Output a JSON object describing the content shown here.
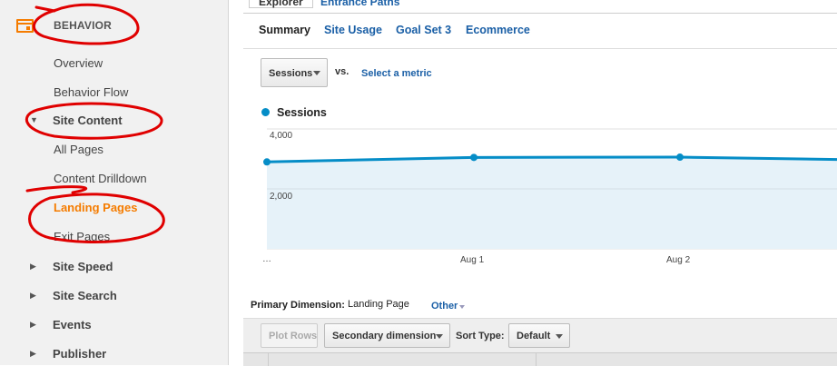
{
  "sidebar": {
    "section_title": "BEHAVIOR",
    "items": [
      {
        "label": "Overview"
      },
      {
        "label": "Behavior Flow"
      },
      {
        "label": "Site Content"
      },
      {
        "label": "All Pages"
      },
      {
        "label": "Content Drilldown"
      },
      {
        "label": "Landing Pages"
      },
      {
        "label": "Exit Pages"
      },
      {
        "label": "Site Speed"
      },
      {
        "label": "Site Search"
      },
      {
        "label": "Events"
      },
      {
        "label": "Publisher"
      }
    ],
    "active_item": "Landing Pages",
    "active_color": "#f57c00",
    "annotation_color": "#e00000"
  },
  "top_tabs": [
    "Explorer",
    "Entrance Paths"
  ],
  "sub_tabs": [
    "Summary",
    "Site Usage",
    "Goal Set 3",
    "Ecommerce"
  ],
  "metric": {
    "selected": "Sessions",
    "vs": "vs.",
    "compare_link": "Select a metric"
  },
  "chart_data": {
    "type": "area",
    "series": [
      {
        "name": "Sessions",
        "values": [
          2900,
          3050,
          3060,
          2980
        ],
        "color": "#058dc7"
      }
    ],
    "x": [
      "…",
      "Aug 1",
      "Aug 2",
      ""
    ],
    "y_ticks": [
      "4,000",
      "2,000"
    ],
    "ylim": [
      0,
      4000
    ],
    "grid": true
  },
  "primary_dimension": {
    "label": "Primary Dimension:",
    "value": "Landing Page",
    "other": "Other"
  },
  "toolbar": {
    "plot_rows": "Plot Rows",
    "secondary_dimension": "Secondary dimension",
    "sort_type_label": "Sort Type:",
    "sort_type_value": "Default"
  }
}
